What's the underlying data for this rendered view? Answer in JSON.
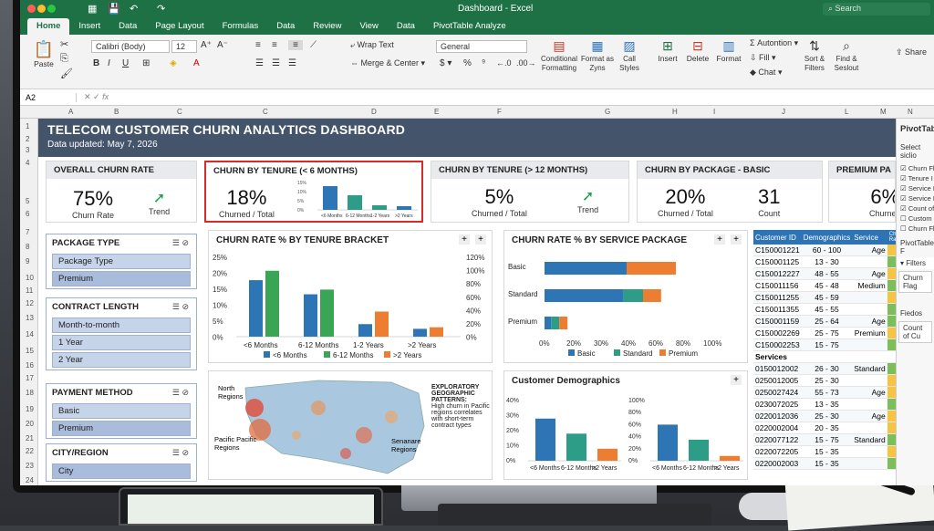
{
  "app": {
    "title": "Dashboard - Excel",
    "search_placeholder": "Search",
    "share": "Share",
    "colors": {
      "excel_green": "#1e7145",
      "banner": "#44546a",
      "blue": "#2e75b6",
      "teal": "#2e9d87",
      "orange": "#ed7d31",
      "highlight": "#d62b2b"
    }
  },
  "tabs": [
    "Home",
    "Insert",
    "Data",
    "Page Layout",
    "Formulas",
    "Data",
    "Review",
    "View",
    "Data",
    "PivotTable Analyze"
  ],
  "ribbon": {
    "paste": "Paste",
    "font_name": "Calibri (Body)",
    "font_size": "12",
    "wrap_text": "Wrap Text",
    "merge_center": "Merge & Center",
    "number_format": "General",
    "conditional_formatting": "Conditional Formatting",
    "format_as_table": "Format as Zyns",
    "cell_styles": "Call Styles",
    "insert": "Insert",
    "delete": "Delete",
    "format": "Format",
    "autosum": "Autontion",
    "fill": "Fill",
    "clear": "Chat",
    "sort_filter": "Sort & Filters",
    "find_select": "Find & Seslout"
  },
  "formula_bar": {
    "name_box": "A2",
    "fx": "fx"
  },
  "columns": [
    "A",
    "B",
    "C",
    "C",
    "D",
    "E",
    "F",
    "G",
    "H",
    "I",
    "J",
    "L",
    "M",
    "N"
  ],
  "rows": [
    "1",
    "2",
    "3",
    "4",
    "5",
    "6",
    "7",
    "8",
    "9",
    "10",
    "11",
    "12",
    "13",
    "14",
    "15",
    "16",
    "17",
    "18",
    "19",
    "20",
    "21",
    "22",
    "23",
    "24",
    "25",
    "26"
  ],
  "dashboard": {
    "title": "TELECOM CUSTOMER CHURN ANALYTICS DASHBOARD",
    "updated": "Data updated: May 7, 2026"
  },
  "kpis": [
    {
      "header": "OVERALL CHURN RATE",
      "value": "75%",
      "label": "Churn Rate",
      "trend_label": "Trend"
    },
    {
      "header": "CHURN BY TENURE (< 6 MONTHS)",
      "value": "18%",
      "label": "Churned / Total"
    },
    {
      "header": "CHURN BY TENURE (> 12 MONTHS)",
      "value": "5%",
      "label": "Churned / Total",
      "trend_label": "Trend"
    },
    {
      "header": "CHURN BY PACKAGE - BASIC",
      "value": "20%",
      "label": "Churned / Total",
      "count": "31",
      "count_label": "Count"
    },
    {
      "header": "PREMIUM PA",
      "value": "6%",
      "label": "Churned"
    }
  ],
  "mini_chart": {
    "type": "bar",
    "categories": [
      "<6 Months",
      "6-12 Months",
      "1-2 Years",
      ">2 Years"
    ],
    "values": [
      13,
      8,
      2.5,
      2
    ],
    "y_ticks": [
      "15%",
      "10%",
      "5%",
      "0%"
    ]
  },
  "slicers": [
    {
      "title": "PACKAGE TYPE",
      "items": [
        "Package Type",
        "Premium"
      ]
    },
    {
      "title": "CONTRACT LENGTH",
      "items": [
        "Month-to-month",
        "1 Year",
        "2 Year"
      ]
    },
    {
      "title": "PAYMENT METHOD",
      "items": [
        "Basic",
        "Premium"
      ]
    },
    {
      "title": "CITY/REGION",
      "items": [
        "City"
      ]
    }
  ],
  "tenure_panel": {
    "title": "CHURN RATE % BY TENURE BRACKET"
  },
  "package_panel": {
    "title": "CHURN RATE % BY SERVICE PACKAGE"
  },
  "demo_panel": {
    "title": "Customer Demographics"
  },
  "map_panel": {
    "labels": [
      "North Regions",
      "Pacific Pacific Regions",
      "Senanare Regions"
    ],
    "note_title": "EXPLORATORY GEOGRAPHIC PATTERNS:",
    "note_body": "High churn in Pacific regions correlates with short-term contract types"
  },
  "chart_data": [
    {
      "type": "bar",
      "categories": [
        "<6 Months",
        "6-12 Months",
        "1-2 Years",
        ">2 Years"
      ],
      "series": [
        {
          "name": "<6 Months",
          "values": [
            18,
            13.5,
            4,
            2.5
          ]
        },
        {
          "name": "6-12 Months",
          "values": [
            21,
            15,
            null,
            null
          ]
        },
        {
          "name": ">2 Years",
          "values": [
            null,
            null,
            8,
            3
          ]
        }
      ],
      "y_ticks": [
        "25%",
        "20%",
        "15%",
        "10%",
        "5%",
        "0%"
      ],
      "y2_ticks": [
        "120%",
        "100%",
        "80%",
        "60%",
        "40%",
        "20%",
        "0%"
      ],
      "ylim": [
        0,
        25
      ]
    },
    {
      "type": "bar",
      "orientation": "horizontal",
      "categories": [
        "Basic",
        "Standard",
        "Premium"
      ],
      "series": [
        {
          "name": "Basic",
          "values": [
            50,
            48,
            4
          ]
        },
        {
          "name": "Standard",
          "values": [
            null,
            12,
            5
          ]
        },
        {
          "name": "Premium",
          "values": [
            30,
            11,
            5
          ]
        }
      ],
      "x_ticks": [
        "0%",
        "20%",
        "30%",
        "40%",
        "60%",
        "80%",
        "100%"
      ],
      "xlim": [
        0,
        100
      ]
    },
    {
      "type": "bar",
      "categories": [
        "<6 Months",
        "6-12 Months",
        ">2 Years"
      ],
      "values": [
        28,
        18,
        8
      ],
      "y_ticks": [
        "40%",
        "30%",
        "20%",
        "10%",
        "0%"
      ],
      "ylim": [
        0,
        40
      ]
    },
    {
      "type": "bar",
      "categories": [
        "<6 Months",
        "6-12 Months",
        ">2 Years"
      ],
      "values": [
        60,
        35,
        8
      ],
      "y_ticks": [
        "100%",
        "80%",
        "60%",
        "40%",
        "20%",
        "0%"
      ],
      "ylim": [
        0,
        100
      ]
    }
  ],
  "table": {
    "headers": [
      "Customer ID",
      "Demographics",
      "Service",
      "Churn Rate"
    ],
    "rows": [
      [
        "C150001221",
        "60 - 100",
        "Age",
        "#f6c342"
      ],
      [
        "C150001125",
        "13 - 30",
        "",
        "#7cbf5a"
      ],
      [
        "C150012227",
        "48 - 55",
        "Age",
        "#f6c342"
      ],
      [
        "C150011156",
        "45 - 48",
        "Medium",
        "#7cbf5a"
      ],
      [
        "C150011255",
        "45 - 59",
        "",
        "#f6c342"
      ],
      [
        "C150011355",
        "45 - 55",
        "",
        "#7cbf5a"
      ],
      [
        "C150001159",
        "25 - 64",
        "Age",
        "#7cbf5a"
      ],
      [
        "C150002269",
        "25 - 75",
        "Premium",
        "#f6c342"
      ],
      [
        "C150002253",
        "15 - 75",
        "",
        "#7cbf5a"
      ],
      [
        "Services",
        "",
        "",
        ""
      ],
      [
        "0150012002",
        "26 - 30",
        "Standard",
        "#7cbf5a"
      ],
      [
        "0250012005",
        "25 - 30",
        "",
        "#f6c342"
      ],
      [
        "0250027424",
        "55 - 73",
        "Age",
        "#f6c342"
      ],
      [
        "0230072025",
        "13 - 35",
        "",
        "#7cbf5a"
      ],
      [
        "0220012036",
        "25 - 30",
        "Age",
        "#f6c342"
      ],
      [
        "0220002004",
        "20 - 35",
        "",
        "#f6c342"
      ],
      [
        "0220077122",
        "15 - 75",
        "Standard",
        "#7cbf5a"
      ],
      [
        "0220072205",
        "15 - 35",
        "",
        "#f6c342"
      ],
      [
        "0220002003",
        "15 - 35",
        "",
        "#7cbf5a"
      ]
    ]
  },
  "pivot": {
    "title": "PivotTab",
    "select": "Select siclio",
    "fields": [
      "Churn Fl",
      "Tenure I",
      "Service F",
      "Service F",
      "Count of",
      "Custom",
      "Churn Fla"
    ],
    "filters_label": "PivotTable F",
    "filters": "Filters",
    "filter_item": "Churn Flag",
    "fields2": "Fiedos",
    "value_item": "Count of Cu"
  }
}
